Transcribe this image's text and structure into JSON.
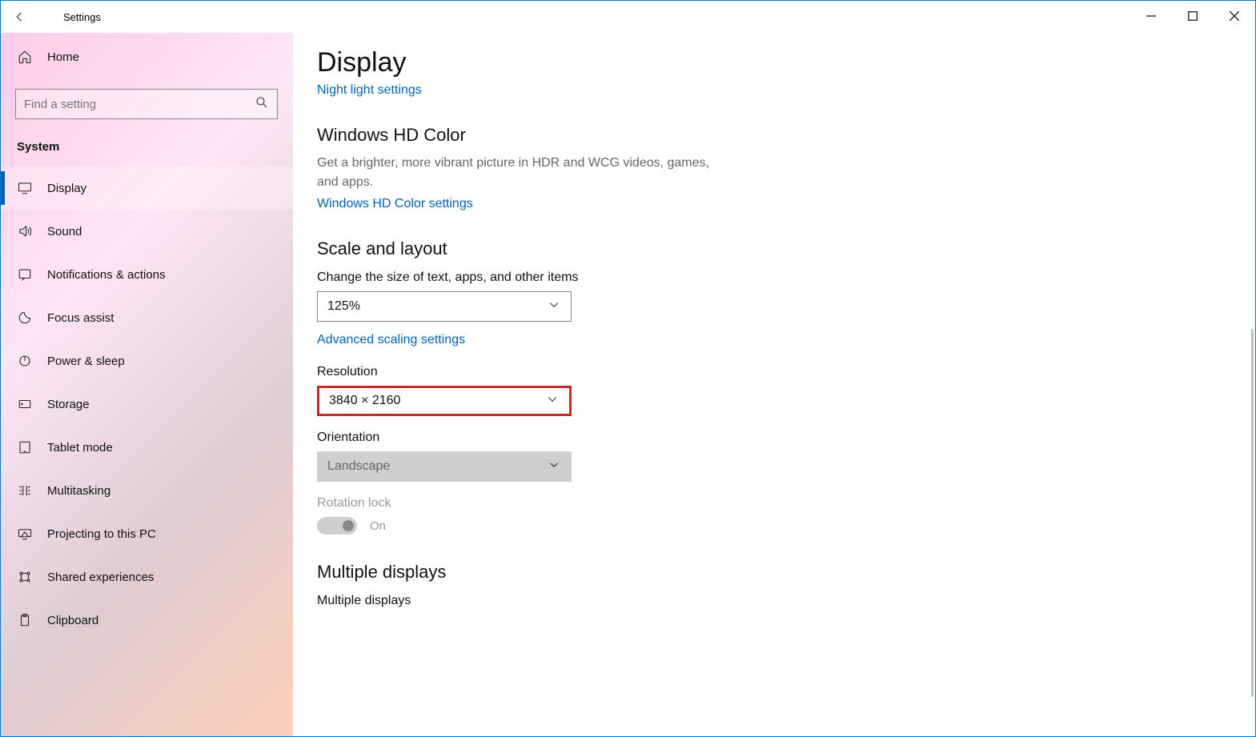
{
  "window": {
    "title": "Settings",
    "minimize": "–",
    "maximize": "▢",
    "close": "✕"
  },
  "sidebar": {
    "home_label": "Home",
    "search_placeholder": "Find a setting",
    "section": "System",
    "items": [
      {
        "label": "Display",
        "icon": "display-icon",
        "active": true
      },
      {
        "label": "Sound",
        "icon": "sound-icon"
      },
      {
        "label": "Notifications & actions",
        "icon": "notifications-icon"
      },
      {
        "label": "Focus assist",
        "icon": "focus-assist-icon"
      },
      {
        "label": "Power & sleep",
        "icon": "power-icon"
      },
      {
        "label": "Storage",
        "icon": "storage-icon"
      },
      {
        "label": "Tablet mode",
        "icon": "tablet-icon"
      },
      {
        "label": "Multitasking",
        "icon": "multitasking-icon"
      },
      {
        "label": "Projecting to this PC",
        "icon": "projecting-icon"
      },
      {
        "label": "Shared experiences",
        "icon": "shared-icon"
      },
      {
        "label": "Clipboard",
        "icon": "clipboard-icon"
      }
    ]
  },
  "main": {
    "title": "Display",
    "night_light_link": "Night light settings",
    "hd_color": {
      "heading": "Windows HD Color",
      "desc": "Get a brighter, more vibrant picture in HDR and WCG videos, games, and apps.",
      "link": "Windows HD Color settings"
    },
    "scale": {
      "heading": "Scale and layout",
      "size_label": "Change the size of text, apps, and other items",
      "size_value": "125%",
      "advanced_link": "Advanced scaling settings",
      "resolution_label": "Resolution",
      "resolution_value": "3840 × 2160",
      "orientation_label": "Orientation",
      "orientation_value": "Landscape",
      "rotation_label": "Rotation lock",
      "rotation_value": "On"
    },
    "multi": {
      "heading": "Multiple displays",
      "label": "Multiple displays"
    }
  }
}
